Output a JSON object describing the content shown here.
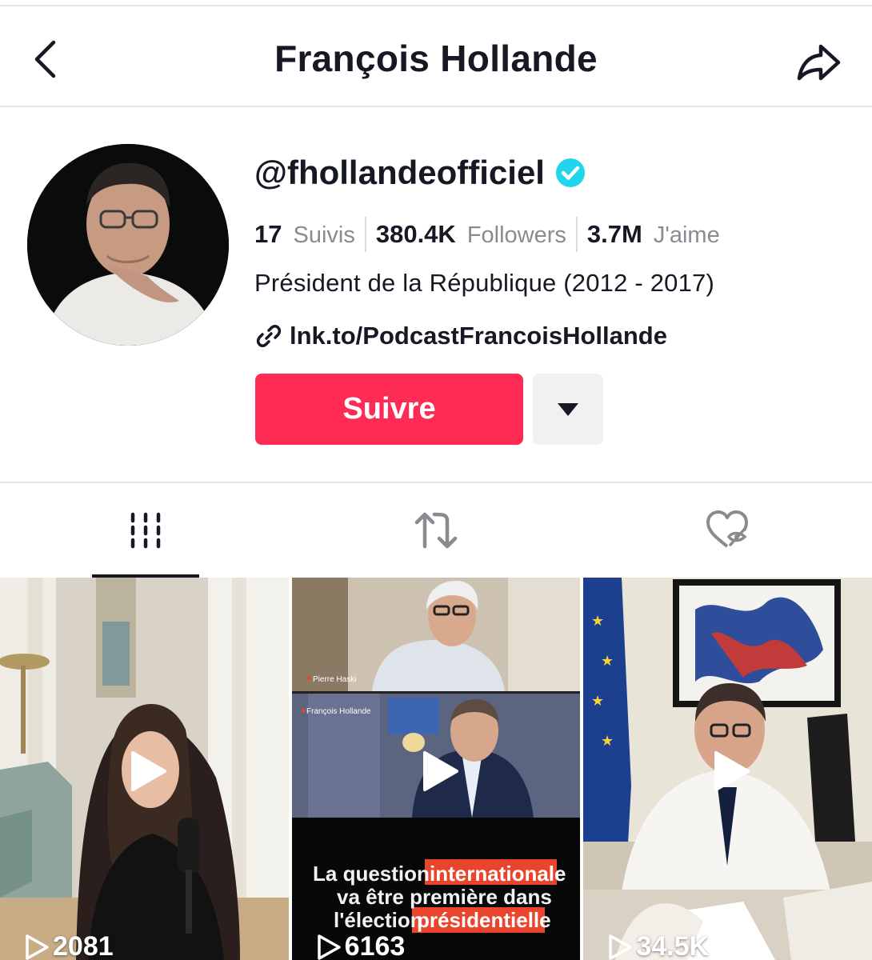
{
  "header": {
    "title": "François Hollande"
  },
  "profile": {
    "username": "@fhollandeofficiel",
    "stats": {
      "following_count": "17",
      "following_label": "Suivis",
      "followers_count": "380.4K",
      "followers_label": "Followers",
      "likes_count": "3.7M",
      "likes_label": "J'aime"
    },
    "bio": "Président de la République (2012 - 2017)",
    "link": "lnk.to/PodcastFrancoisHollande",
    "follow_label": "Suivre"
  },
  "tabs": [
    {
      "icon": "videos-grid-icon",
      "active": true
    },
    {
      "icon": "repost-icon",
      "active": false
    },
    {
      "icon": "liked-hidden-icon",
      "active": false
    }
  ],
  "videos": [
    {
      "views": "2081"
    },
    {
      "views": "6163",
      "overlay_name_top": "Pierre Haski",
      "overlay_name_bottom": "François Hollande",
      "caption_line1_plain": "La question ",
      "caption_line1_highlight": "internationale",
      "caption_line2": "va être première dans",
      "caption_line3_plain": "l'élection ",
      "caption_line3_highlight": "présidentielle"
    },
    {
      "views": "34.5K"
    }
  ],
  "colors": {
    "accent": "#fe2c55",
    "verified": "#20d5ec",
    "text": "#161823",
    "muted": "#8a8b91",
    "caption_highlight": "#e8452c"
  }
}
